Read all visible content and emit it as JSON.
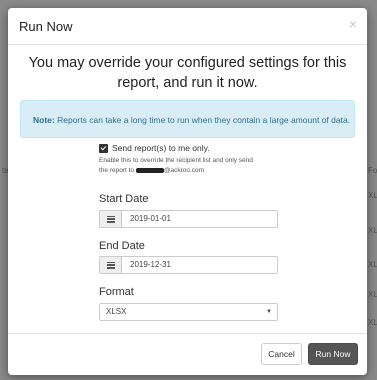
{
  "backdrop": {
    "left_fragment": "ta",
    "right_fragments": [
      "Fo",
      "XLSX",
      "XLS",
      "XLS",
      "XLS",
      "XLS"
    ]
  },
  "modal": {
    "title": "Run Now",
    "close": "×",
    "lead": "You may override your configured settings for this report, and run it now.",
    "note": {
      "label": "Note:",
      "text": "Reports can take a long time to run when they contain a large amount of data."
    },
    "send_to_me": {
      "checked": true,
      "label": "Send report(s) to me only.",
      "help_line1": "Enable this to override the recipient list and only send",
      "help_prefix": "the report to ",
      "help_suffix": "@ackroo.com"
    },
    "start_date": {
      "label": "Start Date",
      "value": "2019-01-01"
    },
    "end_date": {
      "label": "End Date",
      "value": "2019-12-31"
    },
    "format": {
      "label": "Format",
      "value": "XLSX",
      "caret": "▼"
    },
    "buttons": {
      "cancel": "Cancel",
      "run": "Run Now"
    }
  }
}
